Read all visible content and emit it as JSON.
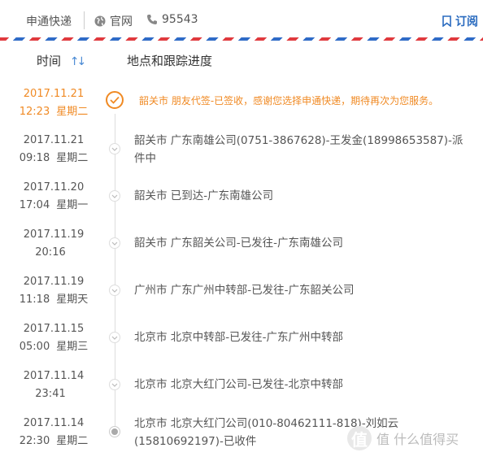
{
  "header": {
    "company": "申通快递",
    "site_label": "官网",
    "phone": "95543",
    "subscribe_label": "订阅"
  },
  "columns": {
    "time": "时间",
    "detail": "地点和跟踪进度"
  },
  "records": [
    {
      "date": "2017.11.21",
      "time": "12:23",
      "weekday": "星期二",
      "text": "韶关市 朋友代签-已签收，感谢您选择申通快递，期待再次为您服务。"
    },
    {
      "date": "2017.11.21",
      "time": "09:18",
      "weekday": "星期二",
      "text": "韶关市 广东南雄公司(0751-3867628)-王发金(18998653587)-派件中"
    },
    {
      "date": "2017.11.20",
      "time": "17:04",
      "weekday": "星期一",
      "text": "韶关市 已到达-广东南雄公司"
    },
    {
      "date": "2017.11.19",
      "time": "20:16",
      "weekday": "",
      "text": "韶关市 广东韶关公司-已发往-广东南雄公司"
    },
    {
      "date": "2017.11.19",
      "time": "11:18",
      "weekday": "星期天",
      "text": "广州市 广东广州中转部-已发往-广东韶关公司"
    },
    {
      "date": "2017.11.15",
      "time": "05:00",
      "weekday": "星期三",
      "text": "北京市 北京中转部-已发往-广东广州中转部"
    },
    {
      "date": "2017.11.14",
      "time": "23:41",
      "weekday": "",
      "text": "北京市 北京大红门公司-已发往-北京中转部"
    },
    {
      "date": "2017.11.14",
      "time": "22:30",
      "weekday": "星期二",
      "text": "北京市 北京大红门公司(010-80462111-818)-刘如云(15810692197)-已收件"
    }
  ],
  "watermark": {
    "text": "值 什么值得买",
    "logo": "值"
  },
  "colors": {
    "accent": "#f08a24",
    "link": "#2a6bbf",
    "airmail_red": "#e03a3e",
    "airmail_blue": "#2f6bc7"
  }
}
